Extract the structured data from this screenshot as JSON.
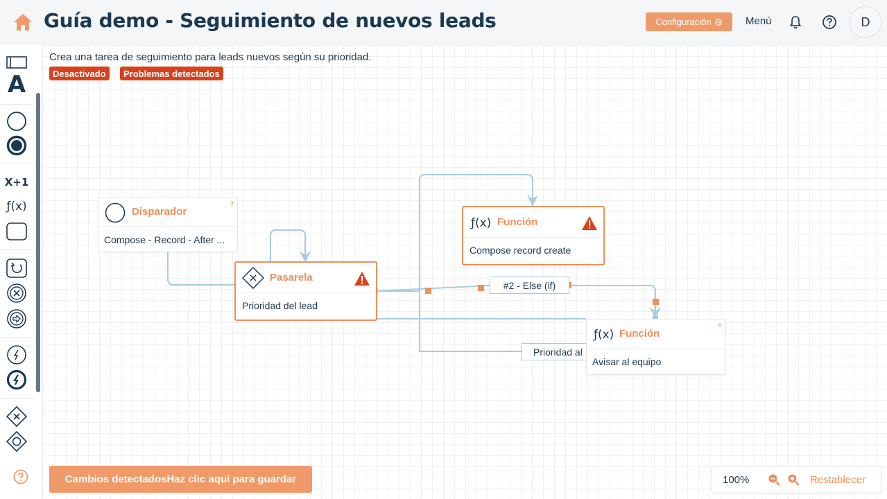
{
  "header": {
    "title": "Guía demo - Seguimiento de nuevos leads",
    "config_label": "Configuración",
    "menu_label": "Menú",
    "avatar_initial": "D",
    "accent_color": "#f09a6a",
    "icons": [
      "home-icon",
      "gear-icon",
      "bell-icon",
      "help-icon"
    ]
  },
  "toolbar": {
    "formula_text": "X+1",
    "function_text": "ƒ(x)",
    "text_tool": "A"
  },
  "flow": {
    "description": "Crea una tarea de seguimiento para leads nuevos según su prioridad.",
    "badges": [
      "Desactivado",
      "Problemas detectados"
    ],
    "badge_color": "#d9401c"
  },
  "nodes": {
    "trigger": {
      "title": "Disparador",
      "body": "Compose - Record - After ...",
      "count": "3"
    },
    "gateway": {
      "title": "Pasarela",
      "body": "Prioridad del lead",
      "warning": true
    },
    "function1": {
      "icon_text": "ƒ(x)",
      "title": "Función",
      "body": "Compose record create",
      "warning": true
    },
    "function2": {
      "icon_text": "ƒ(x)",
      "title": "Función",
      "body": "Avisar al equipo",
      "count": "8"
    }
  },
  "edges": {
    "else_label": "#2 - Else (if)",
    "priority_label": "Prioridad al"
  },
  "footer": {
    "save_label": "Cambios detectadosHaz clic aquí para guardar",
    "zoom_level": "100%",
    "reset_label": "Restablecer"
  }
}
